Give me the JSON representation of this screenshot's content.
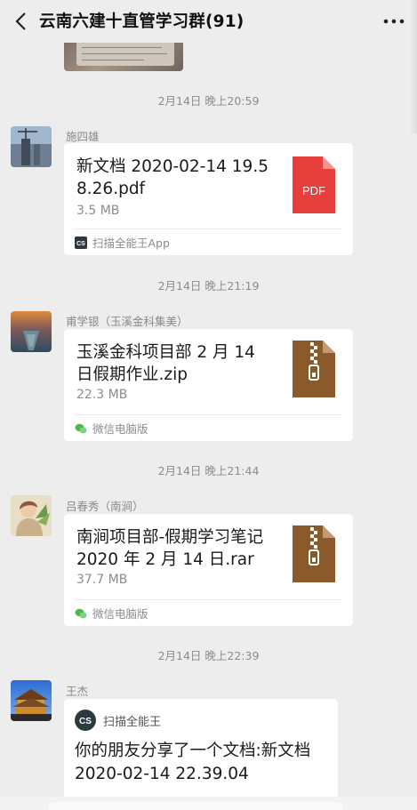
{
  "header": {
    "title": "云南六建十直管学习群(91)",
    "back_icon": "chevron-left-icon",
    "more_icon": "ellipsis-icon"
  },
  "colors": {
    "background": "#ededed",
    "card": "#ffffff",
    "pdf_red": "#e7403c",
    "zip_brown": "#8b5a2b",
    "wechat_green": "#4cb84c",
    "cs_badge": "#2b3a3e"
  },
  "messages": [
    {
      "timestamp": "2月14日 晚上20:59",
      "sender": "施四雄",
      "file_name": "新文档 2020-02-14 19.58.26.pdf",
      "file_size": "3.5 MB",
      "file_icon": "pdf-icon",
      "file_icon_label": "PDF",
      "source": "扫描全能王App",
      "source_icon": "camscanner-icon"
    },
    {
      "timestamp": "2月14日 晚上21:19",
      "sender": "甫学银（玉溪金科集美）",
      "file_name": "玉溪金科项目部 2 月 14 日假期作业.zip",
      "file_size": "22.3 MB",
      "file_icon": "zip-icon",
      "source": "微信电脑版",
      "source_icon": "wechat-icon"
    },
    {
      "timestamp": "2月14日 晚上21:44",
      "sender": "吕春秀（南涧）",
      "file_name": "南涧项目部-假期学习笔记 2020 年 2 月 14 日.rar",
      "file_size": "37.7 MB",
      "file_icon": "rar-icon",
      "source": "微信电脑版",
      "source_icon": "wechat-icon"
    },
    {
      "timestamp": "2月14日 晚上22:39",
      "sender": "王杰",
      "app_name": "扫描全能王",
      "app_icon": "camscanner-icon",
      "app_icon_label": "CS",
      "share_text": "你的朋友分享了一个文档:新文档 2020-02-14 22.39.04"
    }
  ]
}
